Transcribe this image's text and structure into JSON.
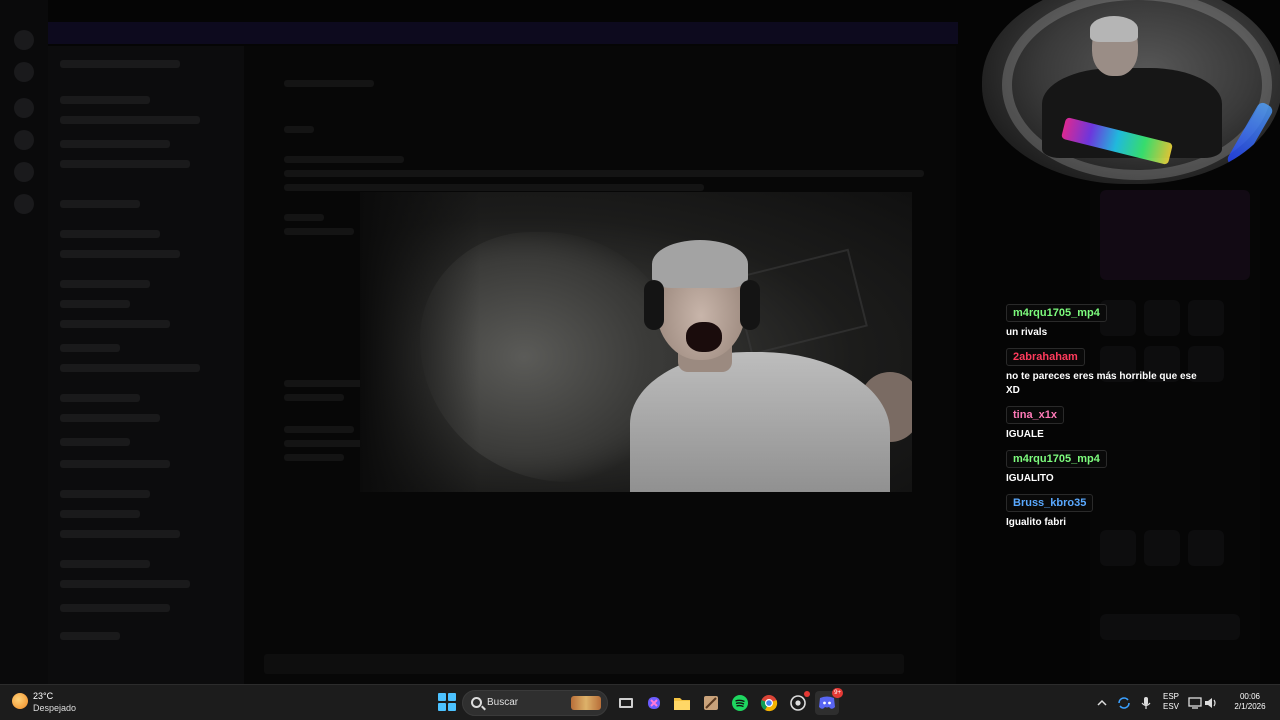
{
  "chat": {
    "messages": [
      {
        "user": "m4rqu1705_mp4",
        "text": "un rivals",
        "color": "#7dfc7d"
      },
      {
        "user": "2abrahaham",
        "text": "no te pareces eres más horrible que ese XD",
        "color": "#ff3b5c"
      },
      {
        "user": "tina_x1x",
        "text": "IGUALE",
        "color": "#ff7ab8"
      },
      {
        "user": "m4rqu1705_mp4",
        "text": "IGUALITO",
        "color": "#7dfc7d"
      },
      {
        "user": "Bruss_kbro35",
        "text": "Igualito fabri",
        "color": "#5aa9ff"
      }
    ]
  },
  "taskbar": {
    "weather": {
      "temp": "23°C",
      "desc": "Despejado"
    },
    "search_placeholder": "Buscar",
    "notification_count": "9+",
    "tray": {
      "lang_line1": "ESP",
      "lang_line2": "ESV",
      "time": "00:06",
      "date": "2/1/2026"
    }
  },
  "colors": {
    "taskbar_bg": "#1c1c1c",
    "accent": "#4cc2ff"
  }
}
